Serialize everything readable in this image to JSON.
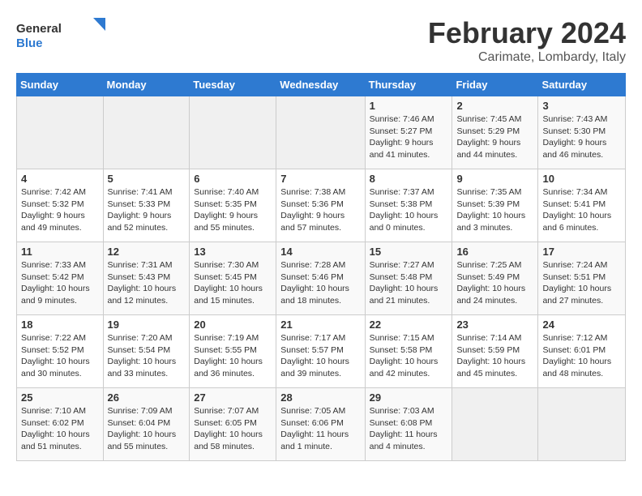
{
  "logo": {
    "general": "General",
    "blue": "Blue"
  },
  "title": "February 2024",
  "location": "Carimate, Lombardy, Italy",
  "days_of_week": [
    "Sunday",
    "Monday",
    "Tuesday",
    "Wednesday",
    "Thursday",
    "Friday",
    "Saturday"
  ],
  "weeks": [
    [
      {
        "num": "",
        "info": ""
      },
      {
        "num": "",
        "info": ""
      },
      {
        "num": "",
        "info": ""
      },
      {
        "num": "",
        "info": ""
      },
      {
        "num": "1",
        "info": "Sunrise: 7:46 AM\nSunset: 5:27 PM\nDaylight: 9 hours\nand 41 minutes."
      },
      {
        "num": "2",
        "info": "Sunrise: 7:45 AM\nSunset: 5:29 PM\nDaylight: 9 hours\nand 44 minutes."
      },
      {
        "num": "3",
        "info": "Sunrise: 7:43 AM\nSunset: 5:30 PM\nDaylight: 9 hours\nand 46 minutes."
      }
    ],
    [
      {
        "num": "4",
        "info": "Sunrise: 7:42 AM\nSunset: 5:32 PM\nDaylight: 9 hours\nand 49 minutes."
      },
      {
        "num": "5",
        "info": "Sunrise: 7:41 AM\nSunset: 5:33 PM\nDaylight: 9 hours\nand 52 minutes."
      },
      {
        "num": "6",
        "info": "Sunrise: 7:40 AM\nSunset: 5:35 PM\nDaylight: 9 hours\nand 55 minutes."
      },
      {
        "num": "7",
        "info": "Sunrise: 7:38 AM\nSunset: 5:36 PM\nDaylight: 9 hours\nand 57 minutes."
      },
      {
        "num": "8",
        "info": "Sunrise: 7:37 AM\nSunset: 5:38 PM\nDaylight: 10 hours\nand 0 minutes."
      },
      {
        "num": "9",
        "info": "Sunrise: 7:35 AM\nSunset: 5:39 PM\nDaylight: 10 hours\nand 3 minutes."
      },
      {
        "num": "10",
        "info": "Sunrise: 7:34 AM\nSunset: 5:41 PM\nDaylight: 10 hours\nand 6 minutes."
      }
    ],
    [
      {
        "num": "11",
        "info": "Sunrise: 7:33 AM\nSunset: 5:42 PM\nDaylight: 10 hours\nand 9 minutes."
      },
      {
        "num": "12",
        "info": "Sunrise: 7:31 AM\nSunset: 5:43 PM\nDaylight: 10 hours\nand 12 minutes."
      },
      {
        "num": "13",
        "info": "Sunrise: 7:30 AM\nSunset: 5:45 PM\nDaylight: 10 hours\nand 15 minutes."
      },
      {
        "num": "14",
        "info": "Sunrise: 7:28 AM\nSunset: 5:46 PM\nDaylight: 10 hours\nand 18 minutes."
      },
      {
        "num": "15",
        "info": "Sunrise: 7:27 AM\nSunset: 5:48 PM\nDaylight: 10 hours\nand 21 minutes."
      },
      {
        "num": "16",
        "info": "Sunrise: 7:25 AM\nSunset: 5:49 PM\nDaylight: 10 hours\nand 24 minutes."
      },
      {
        "num": "17",
        "info": "Sunrise: 7:24 AM\nSunset: 5:51 PM\nDaylight: 10 hours\nand 27 minutes."
      }
    ],
    [
      {
        "num": "18",
        "info": "Sunrise: 7:22 AM\nSunset: 5:52 PM\nDaylight: 10 hours\nand 30 minutes."
      },
      {
        "num": "19",
        "info": "Sunrise: 7:20 AM\nSunset: 5:54 PM\nDaylight: 10 hours\nand 33 minutes."
      },
      {
        "num": "20",
        "info": "Sunrise: 7:19 AM\nSunset: 5:55 PM\nDaylight: 10 hours\nand 36 minutes."
      },
      {
        "num": "21",
        "info": "Sunrise: 7:17 AM\nSunset: 5:57 PM\nDaylight: 10 hours\nand 39 minutes."
      },
      {
        "num": "22",
        "info": "Sunrise: 7:15 AM\nSunset: 5:58 PM\nDaylight: 10 hours\nand 42 minutes."
      },
      {
        "num": "23",
        "info": "Sunrise: 7:14 AM\nSunset: 5:59 PM\nDaylight: 10 hours\nand 45 minutes."
      },
      {
        "num": "24",
        "info": "Sunrise: 7:12 AM\nSunset: 6:01 PM\nDaylight: 10 hours\nand 48 minutes."
      }
    ],
    [
      {
        "num": "25",
        "info": "Sunrise: 7:10 AM\nSunset: 6:02 PM\nDaylight: 10 hours\nand 51 minutes."
      },
      {
        "num": "26",
        "info": "Sunrise: 7:09 AM\nSunset: 6:04 PM\nDaylight: 10 hours\nand 55 minutes."
      },
      {
        "num": "27",
        "info": "Sunrise: 7:07 AM\nSunset: 6:05 PM\nDaylight: 10 hours\nand 58 minutes."
      },
      {
        "num": "28",
        "info": "Sunrise: 7:05 AM\nSunset: 6:06 PM\nDaylight: 11 hours\nand 1 minute."
      },
      {
        "num": "29",
        "info": "Sunrise: 7:03 AM\nSunset: 6:08 PM\nDaylight: 11 hours\nand 4 minutes."
      },
      {
        "num": "",
        "info": ""
      },
      {
        "num": "",
        "info": ""
      }
    ]
  ]
}
